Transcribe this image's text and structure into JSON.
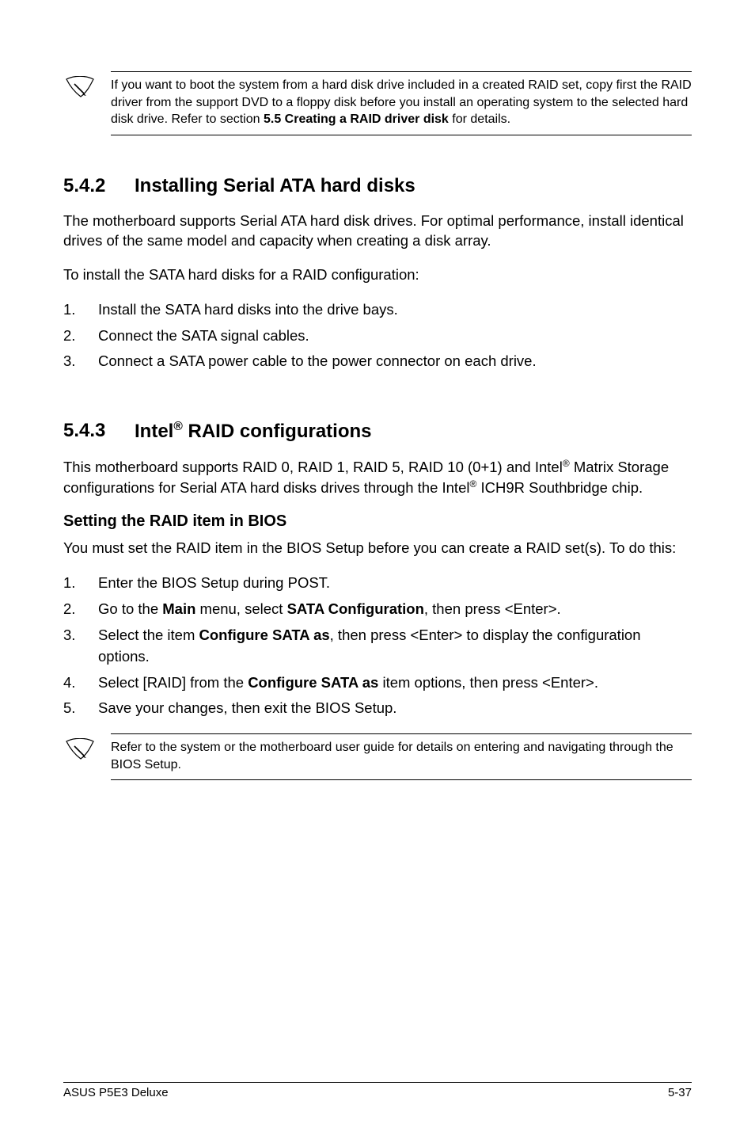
{
  "note_top": {
    "text_parts": [
      "If you want to boot the system from a hard disk drive included in a created RAID set, copy first the RAID driver from the support DVD to a floppy disk before you install an operating system to the selected hard disk drive. Refer to section ",
      "5.5 Creating a RAID driver disk",
      " for details."
    ]
  },
  "sec_5_4_2": {
    "number": "5.4.2",
    "title": "Installing Serial ATA hard disks",
    "para1": "The motherboard supports Serial ATA hard disk drives. For optimal performance, install identical drives of the same model and capacity when creating a disk array.",
    "para2": "To install the SATA hard disks for a RAID configuration:",
    "steps": [
      {
        "n": "1.",
        "t": "Install the SATA hard disks into the drive bays."
      },
      {
        "n": "2.",
        "t": "Connect the SATA signal cables."
      },
      {
        "n": "3.",
        "t": "Connect a SATA power cable to the power connector on each drive."
      }
    ]
  },
  "sec_5_4_3": {
    "number": "5.4.3",
    "title_pre": "Intel",
    "title_sup": "®",
    "title_post": " RAID configurations",
    "para1_pre": "This motherboard supports RAID 0, RAID 1, RAID 5, RAID 10 (0+1) and Intel",
    "para1_sup": "®",
    "para1_mid": " Matrix Storage configurations for Serial ATA hard disks drives through the Intel",
    "para1_sup2": "®",
    "para1_post": " ICH9R Southbridge chip.",
    "subheading": "Setting the RAID item in BIOS",
    "para2": "You must set the RAID item in the BIOS Setup before you can create a RAID set(s). To do this:",
    "steps": [
      {
        "n": "1.",
        "plain": "Enter the BIOS Setup during POST."
      },
      {
        "n": "2.",
        "p1": "Go to the ",
        "b1": "Main",
        "p2": " menu, select ",
        "b2": "SATA Configuration",
        "p3": ", then press <Enter>."
      },
      {
        "n": "3.",
        "p1": "Select the item ",
        "b1": "Configure SATA as",
        "p2": ", then press <Enter> to display the configuration options."
      },
      {
        "n": "4.",
        "p1": "Select [RAID] from the ",
        "b1": "Configure SATA as",
        "p2": " item options, then press <Enter>."
      },
      {
        "n": "5.",
        "plain": "Save your changes, then exit the BIOS Setup."
      }
    ]
  },
  "note_bottom": {
    "text": "Refer to the system or the motherboard user guide for details on entering and navigating through the BIOS Setup."
  },
  "footer": {
    "left": "ASUS P5E3 Deluxe",
    "right": "5-37"
  }
}
